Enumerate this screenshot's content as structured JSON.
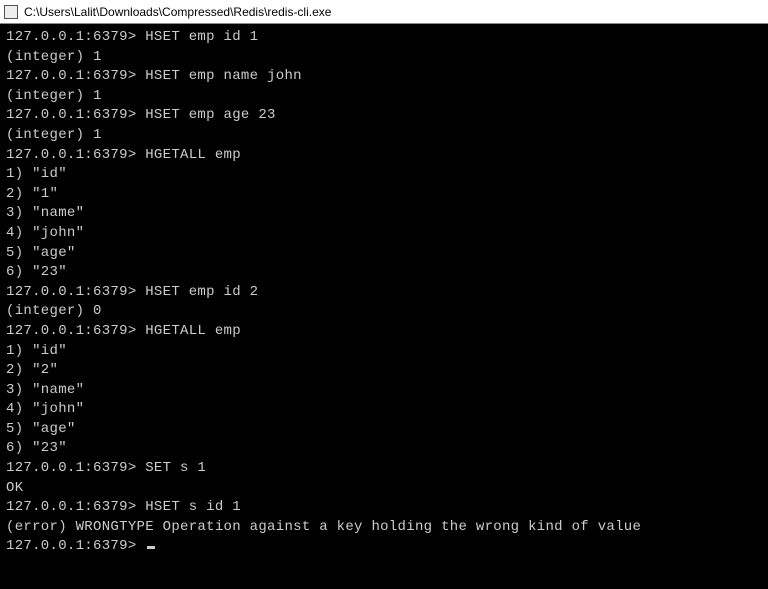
{
  "window": {
    "title": "C:\\Users\\Lalit\\Downloads\\Compressed\\Redis\\redis-cli.exe"
  },
  "terminal": {
    "prompt": "127.0.0.1:6379> ",
    "lines": [
      "127.0.0.1:6379> HSET emp id 1",
      "(integer) 1",
      "127.0.0.1:6379> HSET emp name john",
      "(integer) 1",
      "127.0.0.1:6379> HSET emp age 23",
      "(integer) 1",
      "127.0.0.1:6379> HGETALL emp",
      "1) \"id\"",
      "2) \"1\"",
      "3) \"name\"",
      "4) \"john\"",
      "5) \"age\"",
      "6) \"23\"",
      "127.0.0.1:6379> HSET emp id 2",
      "(integer) 0",
      "127.0.0.1:6379> HGETALL emp",
      "1) \"id\"",
      "2) \"2\"",
      "3) \"name\"",
      "4) \"john\"",
      "5) \"age\"",
      "6) \"23\"",
      "127.0.0.1:6379> SET s 1",
      "OK",
      "127.0.0.1:6379> HSET s id 1",
      "(error) WRONGTYPE Operation against a key holding the wrong kind of value",
      "127.0.0.1:6379> "
    ]
  }
}
